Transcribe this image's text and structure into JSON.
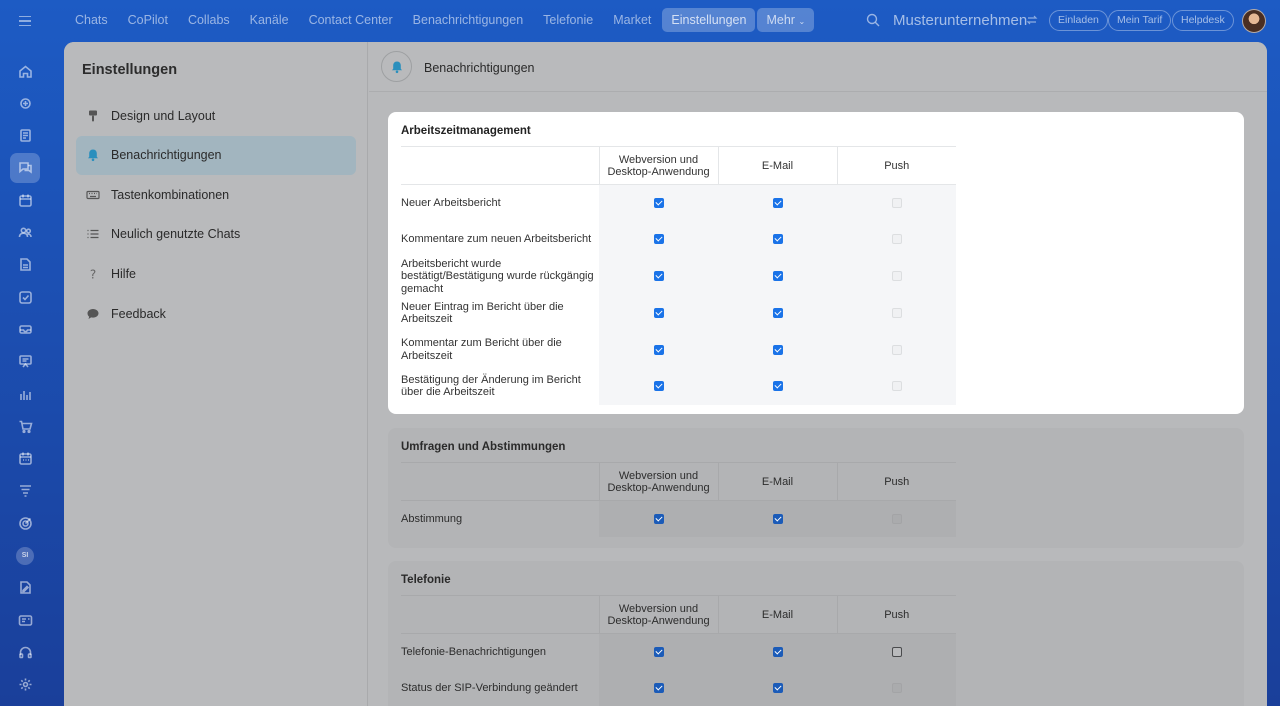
{
  "topnav": {
    "items": [
      "Chats",
      "CoPilot",
      "Collabs",
      "Kanäle",
      "Contact Center",
      "Benachrichtigungen",
      "Telefonie",
      "Market",
      "Einstellungen"
    ],
    "active": "Einstellungen",
    "more_label": "Mehr",
    "company": "Musterunternehmen",
    "buttons": [
      "Einladen",
      "Mein Tarif",
      "Helpdesk"
    ]
  },
  "rail": {
    "icons": [
      "home-icon",
      "copilot-icon",
      "feed-icon",
      "chats-icon",
      "calendar-icon",
      "contacts-icon",
      "documents-icon",
      "tasks-icon",
      "inbox-icon",
      "presentation-icon",
      "analytics-icon",
      "cart-icon",
      "booking-icon",
      "funnel-icon",
      "target-icon",
      "si-avatar",
      "sign-icon",
      "id-card-icon",
      "headset-icon",
      "settings-icon"
    ],
    "active": "chats-icon",
    "si_text": "SI"
  },
  "sidebar": {
    "title": "Einstellungen",
    "items": [
      {
        "label": "Design und Layout",
        "icon": "brush-icon"
      },
      {
        "label": "Benachrichtigungen",
        "icon": "bell-icon"
      },
      {
        "label": "Tastenkombinationen",
        "icon": "keyboard-icon"
      },
      {
        "label": "Neulich genutzte Chats",
        "icon": "list-icon"
      },
      {
        "label": "Hilfe",
        "icon": "question-icon"
      },
      {
        "label": "Feedback",
        "icon": "chat-bubble-icon"
      }
    ],
    "active_index": 1
  },
  "content": {
    "title": "Benachrichtigungen",
    "columns": [
      "Webversion und Desktop-Anwendung",
      "E-Mail",
      "Push"
    ],
    "sections": [
      {
        "title": "Arbeitszeitmanagement",
        "highlighted": true,
        "rows": [
          {
            "label": "Neuer Arbeitsbericht",
            "web": true,
            "email": true,
            "push": false,
            "push_enabled": false
          },
          {
            "label": "Kommentare zum neuen Arbeitsbericht",
            "web": true,
            "email": true,
            "push": false,
            "push_enabled": false
          },
          {
            "label": "Arbeitsbericht wurde bestätigt/Bestätigung wurde rückgängig gemacht",
            "web": true,
            "email": true,
            "push": false,
            "push_enabled": false
          },
          {
            "label": "Neuer Eintrag im Bericht über die Arbeitszeit",
            "web": true,
            "email": true,
            "push": false,
            "push_enabled": false
          },
          {
            "label": "Kommentar zum Bericht über die Arbeitszeit",
            "web": true,
            "email": true,
            "push": false,
            "push_enabled": false
          },
          {
            "label": "Bestätigung der Änderung im Bericht über die Arbeitszeit",
            "web": true,
            "email": true,
            "push": false,
            "push_enabled": false
          }
        ]
      },
      {
        "title": "Umfragen und Abstimmungen",
        "highlighted": false,
        "rows": [
          {
            "label": "Abstimmung",
            "web": true,
            "email": true,
            "push": false,
            "push_enabled": false
          }
        ]
      },
      {
        "title": "Telefonie",
        "highlighted": false,
        "rows": [
          {
            "label": "Telefonie-Benachrichtigungen",
            "web": true,
            "email": true,
            "push": false,
            "push_enabled": true
          },
          {
            "label": "Status der SIP-Verbindung geändert",
            "web": true,
            "email": true,
            "push": false,
            "push_enabled": false
          }
        ]
      }
    ]
  },
  "colors": {
    "accent": "#1a73e8",
    "bg_top": "#1d5bc4",
    "active_item": "#a2b5bf"
  }
}
